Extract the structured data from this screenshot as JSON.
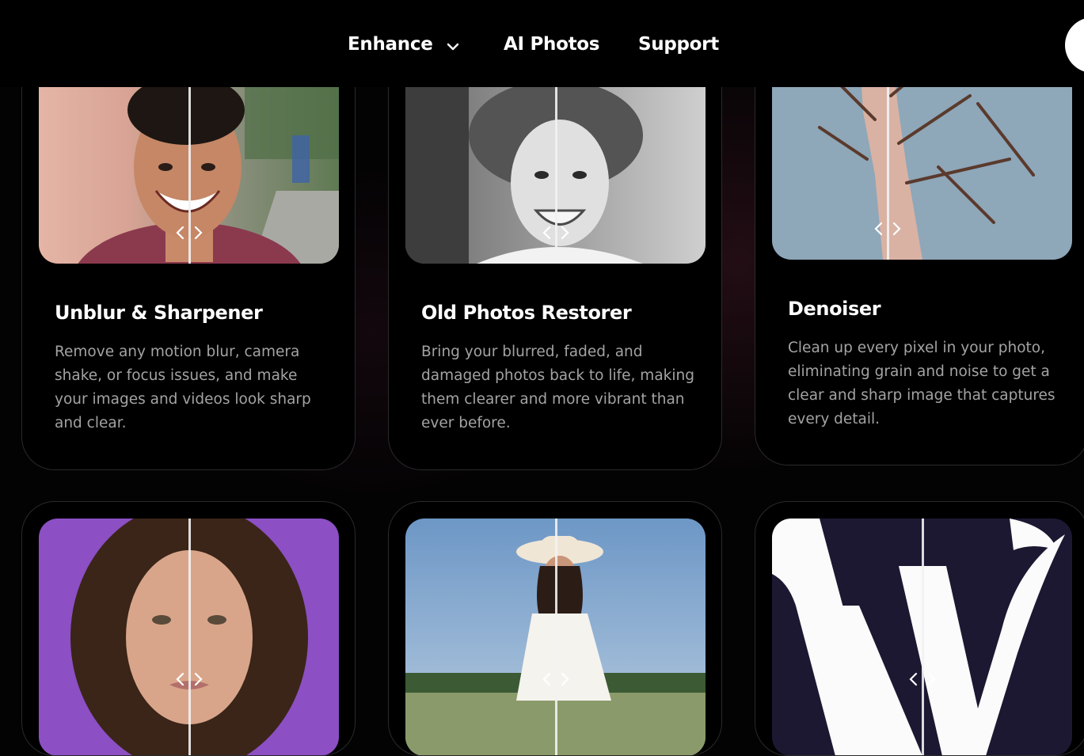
{
  "nav": {
    "items": [
      {
        "label": "Enhance",
        "has_dropdown": true
      },
      {
        "label": "AI Photos"
      },
      {
        "label": "Support"
      }
    ]
  },
  "cards": [
    {
      "title": "Unblur & Sharpener",
      "description": "Remove any motion blur, camera shake, or focus issues, and make your images and videos look sharp and clear."
    },
    {
      "title": "Old Photos Restorer",
      "description": "Bring your blurred, faded, and damaged photos back to life, making them clearer and more vibrant than ever before."
    },
    {
      "title": "Denoiser",
      "description": "Clean up every pixel in your photo, eliminating grain and noise to get a clear and sharp image that captures every detail."
    }
  ],
  "colors": {
    "background": "#000000",
    "card_border": "#2a2a2a",
    "title": "#ffffff",
    "description": "#a3a3a3"
  },
  "icons": [
    "chevron-down-icon",
    "compare-arrows-icon"
  ]
}
